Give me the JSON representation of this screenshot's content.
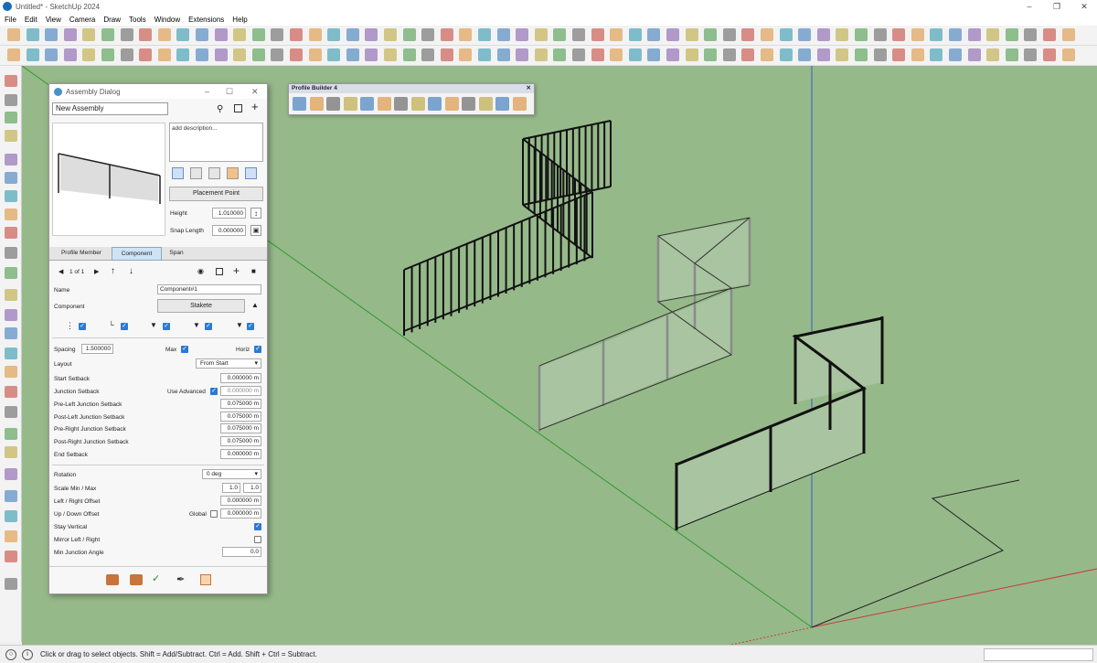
{
  "window": {
    "title": "Untitled* - SketchUp 2024"
  },
  "menu": [
    "File",
    "Edit",
    "View",
    "Camera",
    "Draw",
    "Tools",
    "Window",
    "Extensions",
    "Help"
  ],
  "status": {
    "text": "Click or drag to select objects. Shift = Add/Subtract. Ctrl = Add. Shift + Ctrl = Subtract."
  },
  "profile_builder": {
    "title": "Profile Builder 4"
  },
  "dialog": {
    "title": "Assembly Dialog",
    "name_value": "New Assembly",
    "description_placeholder": "add description...",
    "placement_button": "Placement Point",
    "height_label": "Height",
    "height_value": "1.010000",
    "snap_label": "Snap Length",
    "snap_value": "0.000000",
    "tabs": [
      "Profile Member",
      "Component",
      "Span"
    ],
    "pager": "1 of 1",
    "name_label": "Name",
    "component_name": "Component#1",
    "component_label": "Component",
    "component_value": "Stakete",
    "spacing_label": "Spacing",
    "spacing_value": "1.500000",
    "max_label": "Max",
    "horiz_label": "Horiz",
    "layout_label": "Layout",
    "layout_value": "From Start",
    "use_advanced_label": "Use Advanced",
    "rows": [
      {
        "label": "Start Setback",
        "value": "0.000000 m"
      },
      {
        "label": "Junction Setback",
        "value": "0.000000 m"
      },
      {
        "label": "Pre-Left Junction Setback",
        "value": "0.075000 m"
      },
      {
        "label": "Post-Left Junction Setback",
        "value": "0.075000 m"
      },
      {
        "label": "Pre-Right Junction Setback",
        "value": "0.075000 m"
      },
      {
        "label": "Post-Right Junction Setback",
        "value": "0.075000 m"
      },
      {
        "label": "End Setback",
        "value": "0.000000 m"
      }
    ],
    "rotation_label": "Rotation",
    "rotation_value": "0 deg",
    "scale_label": "Scale Min / Max",
    "scale_min": "1.0",
    "scale_max": "1.0",
    "lr_offset_label": "Left / Right Offset",
    "lr_offset_value": "0.000000 m",
    "ud_offset_label": "Up / Down Offset",
    "global_label": "Global",
    "ud_offset_value": "0.000000 m",
    "stay_vertical_label": "Stay Vertical",
    "mirror_label": "Mirror Left / Right",
    "min_angle_label": "Min Junction Angle",
    "min_angle_value": "0.0"
  },
  "colors": {
    "viewport": "#96b98a",
    "accent": "#2a7ad6",
    "axis_green": "#2e9a2e",
    "axis_blue": "#3a5ac8",
    "axis_red": "#c83a3a"
  }
}
